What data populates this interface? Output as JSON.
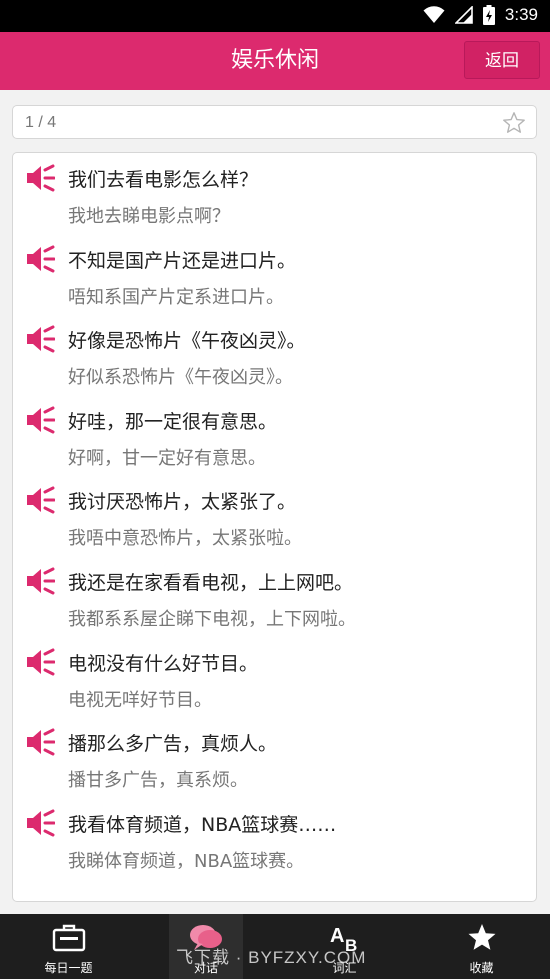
{
  "status_bar": {
    "time": "3:39"
  },
  "header": {
    "title": "娱乐休闲",
    "back_label": "返回"
  },
  "pager": {
    "count": "1 / 4"
  },
  "dialogue": [
    {
      "mandarin": "我们去看电影怎么样？",
      "cantonese": "我地去睇电影点啊？"
    },
    {
      "mandarin": "不知是国产片还是进口片。",
      "cantonese": "唔知系国产片定系进口片。"
    },
    {
      "mandarin": "好像是恐怖片《午夜凶灵》。",
      "cantonese": "好似系恐怖片《午夜凶灵》。"
    },
    {
      "mandarin": "好哇，那一定很有意思。",
      "cantonese": "好啊，甘一定好有意思。"
    },
    {
      "mandarin": "我讨厌恐怖片，太紧张了。",
      "cantonese": "我唔中意恐怖片，太紧张啦。"
    },
    {
      "mandarin": "我还是在家看看电视，上上网吧。",
      "cantonese": "我都系系屋企睇下电视，上下网啦。"
    },
    {
      "mandarin": "电视没有什么好节目。",
      "cantonese": "电视无咩好节目。"
    },
    {
      "mandarin": "播那么多广告，真烦人。",
      "cantonese": "播甘多广告，真系烦。"
    },
    {
      "mandarin": "我看体育频道，NBA篮球赛……",
      "cantonese": "我睇体育频道，NBA篮球赛。"
    }
  ],
  "tabs": [
    {
      "label": "每日一题",
      "icon": "briefcase-icon"
    },
    {
      "label": "对话",
      "icon": "chat-bubbles-icon"
    },
    {
      "label": "词汇",
      "icon": "ab-letters-icon"
    },
    {
      "label": "收藏",
      "icon": "star-icon"
    }
  ],
  "watermark": "飞下载 · BYFZXY.COM",
  "colors": {
    "accent": "#dc2a6e",
    "tabbar": "#1e1e1e",
    "speaker": "#dc2a6e"
  }
}
